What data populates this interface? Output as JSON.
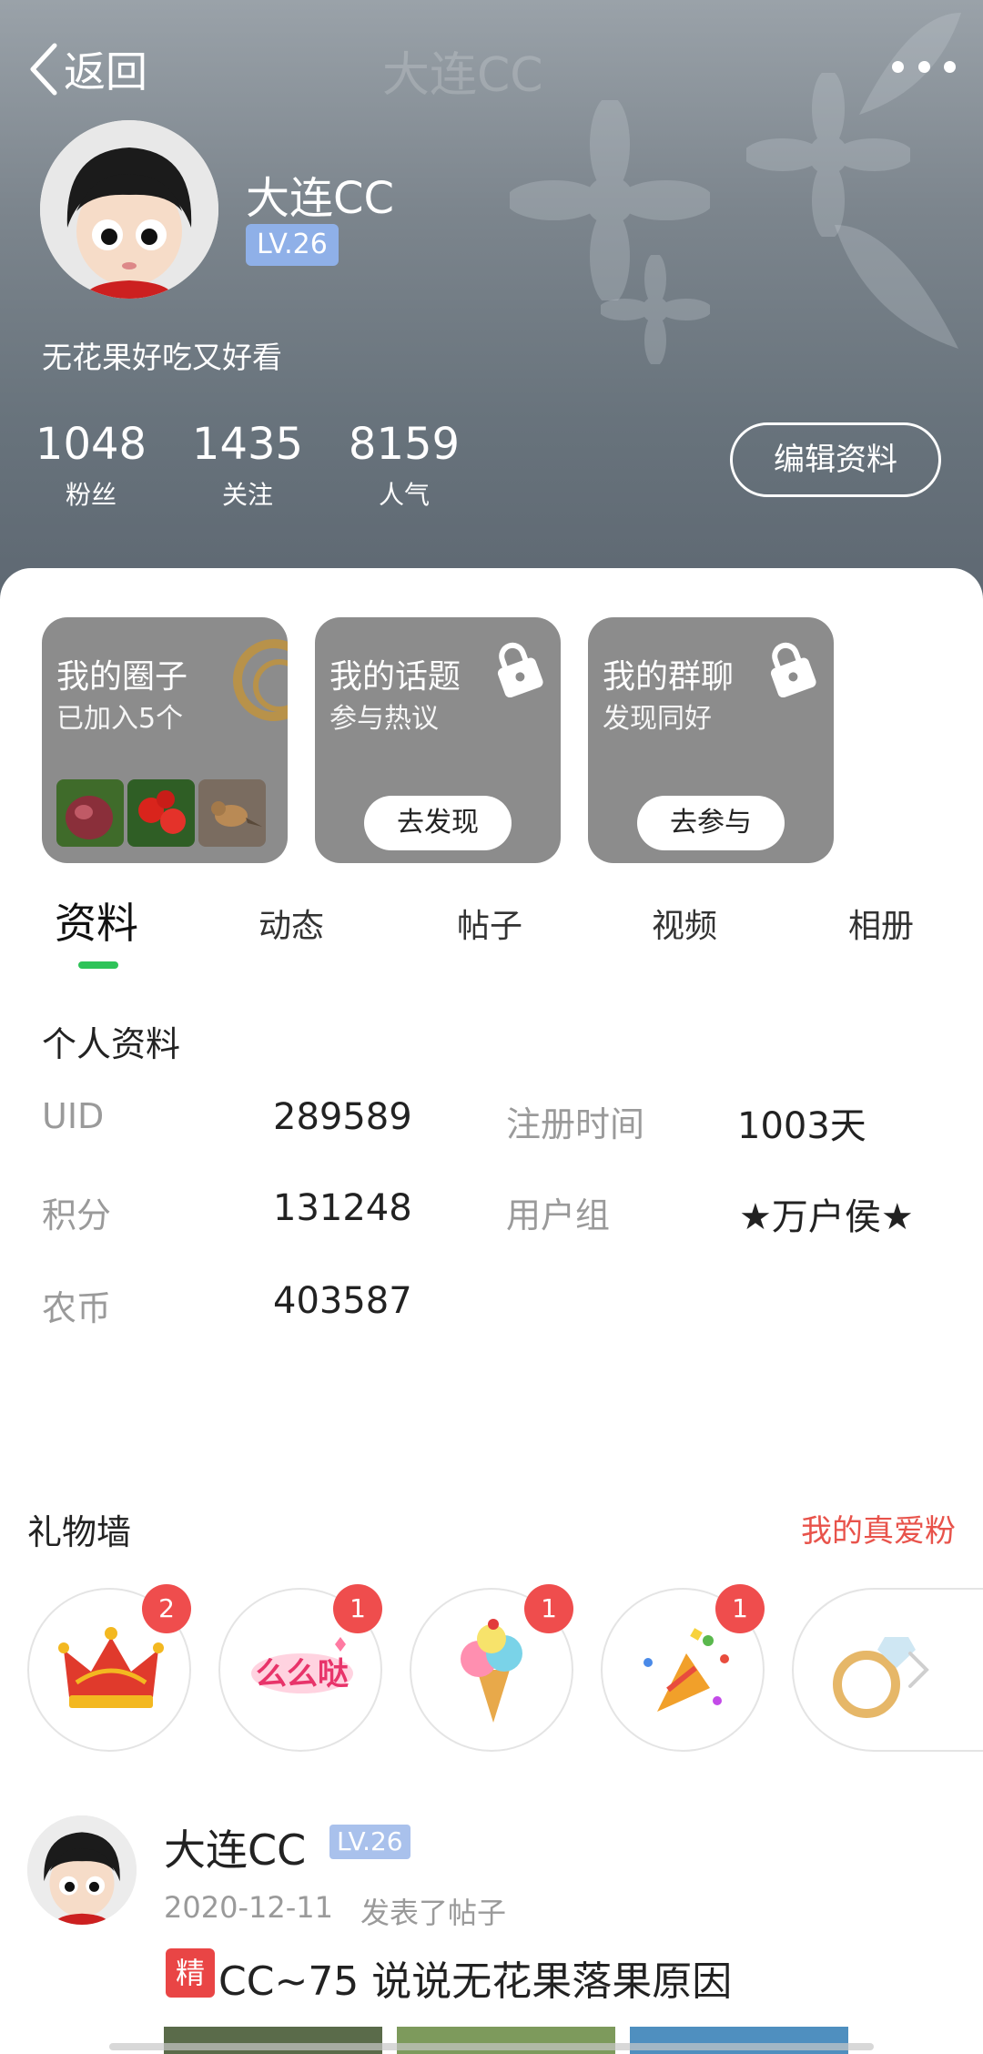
{
  "header": {
    "back_label": "返回",
    "ghost_title": "大连CC",
    "username": "大连CC",
    "level": "LV.26",
    "bio": "无花果好吃又好看",
    "stats": [
      {
        "value": "1048",
        "label": "粉丝"
      },
      {
        "value": "1435",
        "label": "关注"
      },
      {
        "value": "8159",
        "label": "人气"
      }
    ],
    "edit_label": "编辑资料"
  },
  "cards": [
    {
      "title": "我的圈子",
      "subtitle": "已加入5个"
    },
    {
      "title": "我的话题",
      "subtitle": "参与热议",
      "button": "去发现"
    },
    {
      "title": "我的群聊",
      "subtitle": "发现同好",
      "button": "去参与"
    }
  ],
  "tabs": [
    "资料",
    "动态",
    "帖子",
    "视频",
    "相册"
  ],
  "profile": {
    "section_title": "个人资料",
    "fields": [
      {
        "label": "UID",
        "value": "289589"
      },
      {
        "label": "注册时间",
        "value": "1003天"
      },
      {
        "label": "积分",
        "value": "131248"
      },
      {
        "label": "用户组",
        "value": "★万户侯★"
      },
      {
        "label": "农币",
        "value": "403587"
      }
    ]
  },
  "gifts": {
    "title": "礼物墙",
    "fans_link": "我的真爱粉",
    "items": [
      {
        "icon": "crown-icon",
        "count": "2"
      },
      {
        "icon": "text-sticker-icon",
        "sticker_text": "么么哒",
        "count": "1"
      },
      {
        "icon": "ice-cream-icon",
        "count": "1"
      },
      {
        "icon": "party-popper-icon",
        "count": "1"
      },
      {
        "icon": "ring-icon"
      }
    ]
  },
  "post": {
    "username": "大连CC",
    "level": "LV.26",
    "date": "2020-12-11",
    "action": "发表了帖子",
    "essence_tag": "精",
    "title": "CC~75 说说无花果落果原因"
  },
  "colors": {
    "accent_green": "#2ec358",
    "link_red": "#e8534b",
    "badge_red": "#ef4d4d",
    "level_blue": "#8fb0e8"
  }
}
